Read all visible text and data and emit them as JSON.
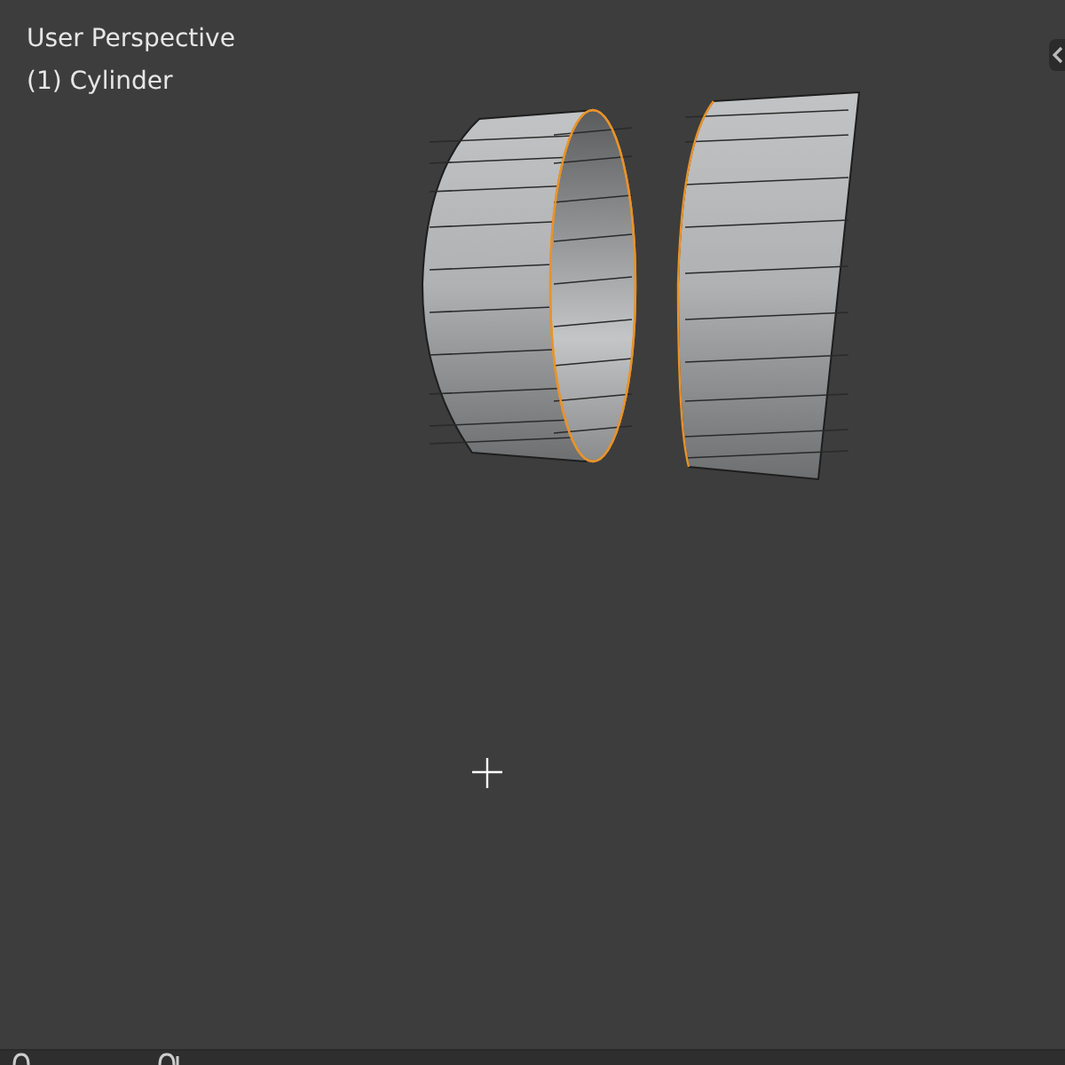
{
  "viewport": {
    "view_name": "User Perspective",
    "object_label": "(1) Cylinder"
  }
}
